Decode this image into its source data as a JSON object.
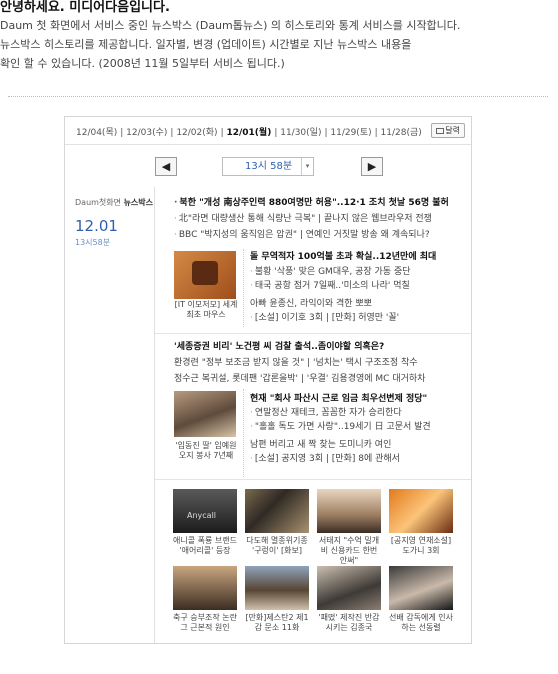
{
  "intro": {
    "title": "안녕하세요. 미디어다음입니다.",
    "lines": [
      "Daum 첫 화면에서 서비스 중인 뉴스박스 (Daum톱뉴스) 의 히스토리와 통계 서비스를 시작합니다.",
      "뉴스박스 히스토리를 제공합니다. 일자별, 변경 (업데이트) 시간별로 지난 뉴스박스 내용을",
      "확인 할 수 있습니다. (2008년 11월 5일부터 서비스 됩니다.)"
    ]
  },
  "datebar": {
    "dates": [
      "12/04(목)",
      "12/03(수)",
      "12/02(화)",
      "12/01(월)",
      "11/30(일)",
      "11/29(토)",
      "11/28(금)"
    ],
    "active_date": "12/01(월)",
    "print_label": "달력"
  },
  "timenav": {
    "prev": "◀",
    "next": "▶",
    "time": "13시 58분",
    "dropdown": "▾"
  },
  "left": {
    "brand_prefix": "Daum첫화면",
    "brand_name": "뉴스박스",
    "date": "12.01",
    "time": "13시58분"
  },
  "s1": {
    "headline": "북한 \"개성 南상주인력 880여명만 허용\"..12·1 조치 첫날 56명 불허",
    "items": [
      "北\"라면 대량생산 통해 식량난 극복\" | 끝나지 않은 웹브라우저 전쟁",
      "BBC \"박지성의 움직임은 압권\" | 연예인 거짓말 방송 왜 계속되나?"
    ]
  },
  "s2": {
    "caption": "[IT 이모저모] 세계 최초 마우스",
    "headline": "돌 무역적자 100억불 초과 확실..12년만에 최대",
    "items": [
      "불황 '삭풍' 맞은 GM대우, 공장 가동 중단",
      "태국 공항 점거 7일째..'미소의 나라' 먹칠",
      "아빠 윤종신, 라익이와 격한 뽀뽀",
      "[소설] 이기호 3회 | [만화] 허영만 '꼴'"
    ]
  },
  "s3": {
    "headline": "'세종증권 비리' 노건평 씨 검찰 출석..좀이야할 의혹은?",
    "items": [
      "환경련 \"정부 보조금 받지 않을 것\" | '넘치는' 택시 구조조정 착수",
      "정수근 복귀설, 롯데팬 '갑론을박' | '우결' 김용경영에 MC 대거하차"
    ]
  },
  "s4": {
    "caption": "'입동진 딸' 임예원 오지 봉사 7년째",
    "headline": "현재 \"회사 파산시 근로 임금 최우선변제 정당\"",
    "items": [
      "연말정산 재테크, 꼼꼼한 자가 승리한다",
      "\"홀홀 독도 가면 사랑\"..19세기 日 고문서 발견",
      "남편 버리고 새 짝 찾는 도미니카 여인",
      "[소설] 공지영 3회 | [만화] 8에 관해서"
    ]
  },
  "grid": [
    {
      "caption": "애니콜 폭룡 브랜드 '애어리콜' 등장",
      "overlay": "Anycall"
    },
    {
      "caption": "다도해 멸종위기종 '구렁이' [화보]"
    },
    {
      "caption": "서태지 \"수억 밀개비 신용카드 한번 안써\""
    },
    {
      "caption": "[공지영 연재소설] 도가니 3회"
    },
    {
      "caption": "축구 승부조작 논란 그 근본적 원인"
    },
    {
      "caption": "[만화]제스탄2 제1감 문소 11화"
    },
    {
      "caption": "'패떴' 제작진 반감시키는 김종국"
    },
    {
      "caption": "선배 감독에게 인사 하는 선동렬"
    }
  ]
}
